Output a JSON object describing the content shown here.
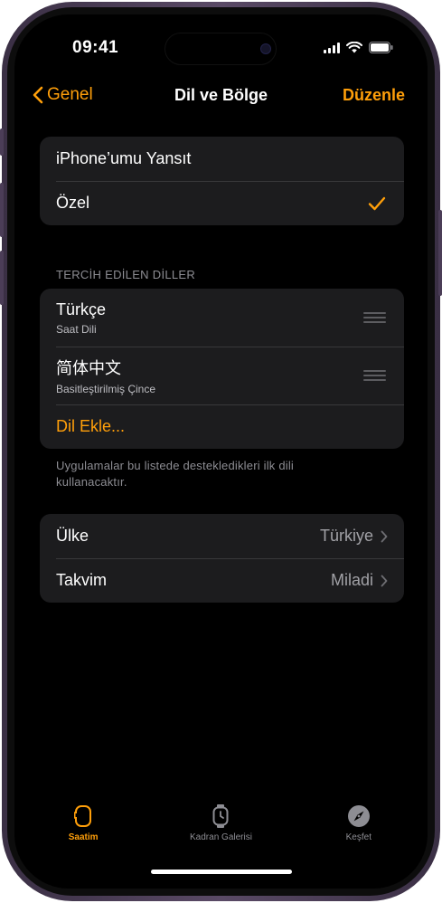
{
  "status": {
    "time": "09:41"
  },
  "nav": {
    "back_label": "Genel",
    "title": "Dil ve Bölge",
    "edit_label": "Düzenle"
  },
  "mode_group": {
    "items": [
      {
        "label": "iPhone’umu Yansıt",
        "checked": false
      },
      {
        "label": "Özel",
        "checked": true
      }
    ]
  },
  "languages": {
    "header": "TERCİH EDİLEN DİLLER",
    "items": [
      {
        "name": "Türkçe",
        "subtitle": "Saat Dili"
      },
      {
        "name": "简体中文",
        "subtitle": "Basitleştirilmiş Çince"
      }
    ],
    "add_label": "Dil Ekle...",
    "footer": "Uygulamalar bu listede destekledikleri ilk dili kullanacaktır."
  },
  "region_group": {
    "items": [
      {
        "label": "Ülke",
        "value": "Türkiye"
      },
      {
        "label": "Takvim",
        "value": "Miladi"
      }
    ]
  },
  "tabbar": {
    "tabs": [
      {
        "label": "Saatim",
        "icon": "watch-icon",
        "active": true
      },
      {
        "label": "Kadran Galerisi",
        "icon": "watch-face-icon",
        "active": false
      },
      {
        "label": "Keşfet",
        "icon": "compass-icon",
        "active": false
      }
    ]
  },
  "colors": {
    "accent": "#ff9f0a",
    "background": "#000000",
    "cell": "#1c1c1e"
  }
}
